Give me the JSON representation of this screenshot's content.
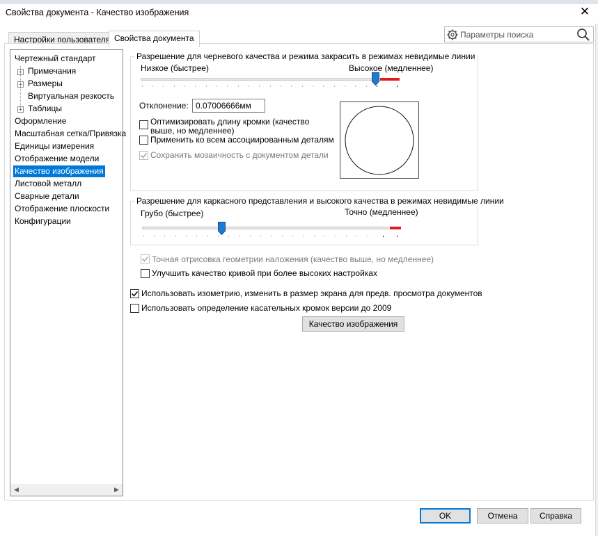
{
  "window": {
    "title": "Свойства документа - Качество изображения"
  },
  "tabs": [
    {
      "label": "Настройки пользователя"
    },
    {
      "label": "Свойства документа"
    }
  ],
  "search": {
    "placeholder": "Параметры поиска"
  },
  "tree": {
    "items": [
      {
        "label": "Чертежный стандарт"
      },
      {
        "label": "Примечания"
      },
      {
        "label": "Размеры"
      },
      {
        "label": "Виртуальная резкость"
      },
      {
        "label": "Таблицы"
      },
      {
        "label": "Оформление"
      },
      {
        "label": "Масштабная сетка/Привязка"
      },
      {
        "label": "Единицы измерения"
      },
      {
        "label": "Отображение модели"
      },
      {
        "label": "Качество изображения"
      },
      {
        "label": "Листовой металл"
      },
      {
        "label": "Сварные детали"
      },
      {
        "label": "Отображение плоскости"
      },
      {
        "label": "Конфигурации"
      }
    ],
    "selected": "Качество изображения"
  },
  "shaded_group": {
    "title": "Разрешение для черневого качества и режима закрасить в режимах невидимые линии",
    "low_label": "Низкое (быстрее)",
    "high_label": "Высокое (медленнее)",
    "slider_level": 0.9,
    "deviation_label": "Отклонение:",
    "deviation_value": "0.07006666мм",
    "optimize_label_1": "Оптимизировать длину кромки (качество",
    "optimize_label_2": "выше, но медленнее)",
    "apply_all_label": "Применить ко всем ассоциированным деталям",
    "save_tess_label": "Сохранить мозаичность с документом детали"
  },
  "wire_group": {
    "title": "Разрешение для каркасного представления и высокого качества в режимах невидимые линии",
    "low_label": "Грубо (быстрее)",
    "high_label": "Точно (медленнее)",
    "slider_level": 0.3
  },
  "options": {
    "precise_render_label": "Точная отрисовка геометрии наложения (качество выше, но медленнее)",
    "improve_curve_label": "Улучшить качество кривой при более высоких настройках",
    "isometric_label": "Использовать изометрию, изменить в размер экрана для предв. просмотра документов",
    "tangent_label": "Использовать определение касательных кромок версии до 2009",
    "image_quality_button": "Качество изображения"
  },
  "buttons": {
    "ok": "OK",
    "cancel": "Отмена",
    "help": "Справка"
  },
  "colors": {
    "accent": "#0078d7",
    "slider_red": "#e51b1b"
  }
}
